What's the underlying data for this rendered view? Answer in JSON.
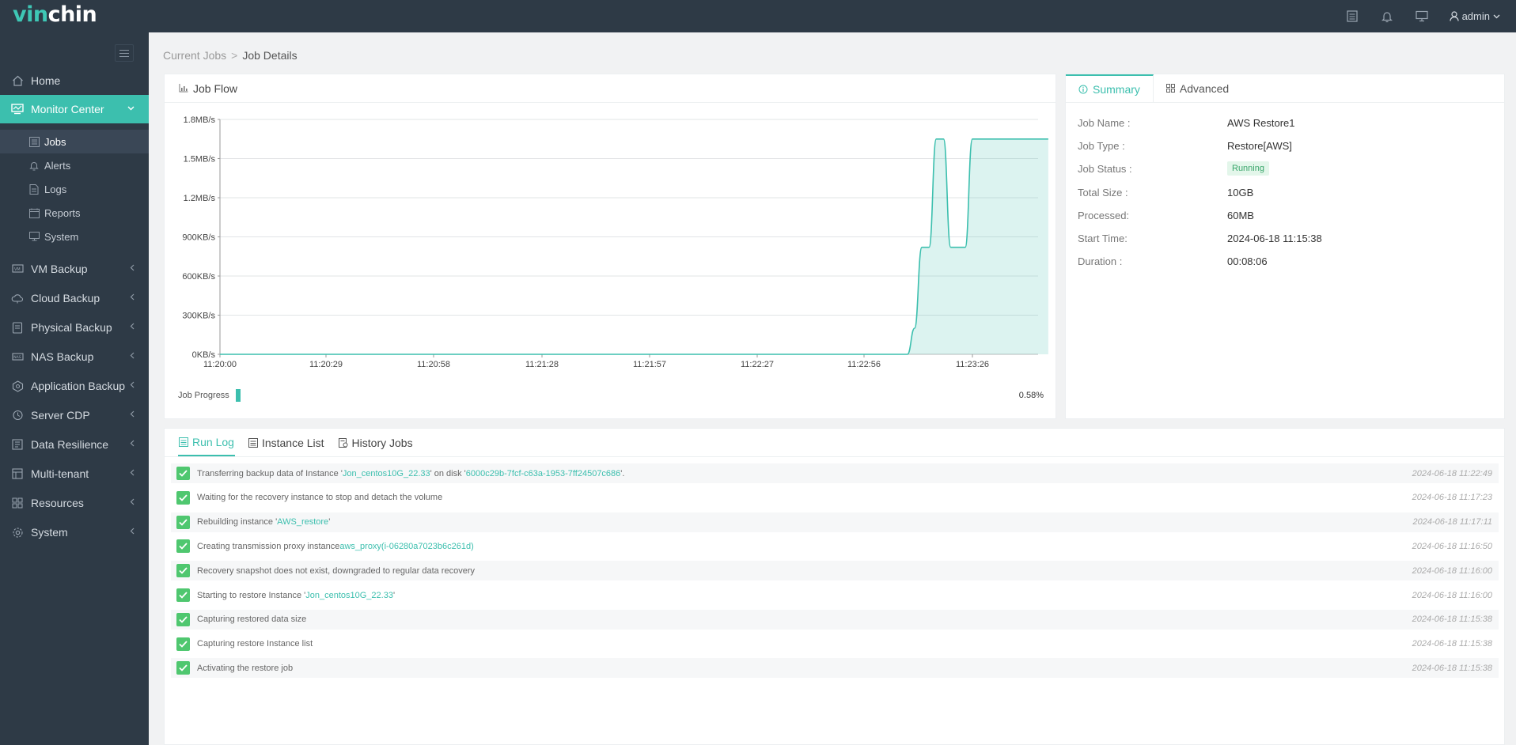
{
  "app": {
    "logo_prefix": "vin",
    "logo_suffix": "chin",
    "user": "admin"
  },
  "sidebar": {
    "items": [
      {
        "label": "Home",
        "icon": "home-icon"
      },
      {
        "label": "Monitor Center",
        "icon": "monitor-icon",
        "active": true
      },
      {
        "label": "VM Backup",
        "icon": "vm-icon"
      },
      {
        "label": "Cloud Backup",
        "icon": "cloud-icon"
      },
      {
        "label": "Physical Backup",
        "icon": "server-icon"
      },
      {
        "label": "NAS Backup",
        "icon": "nas-icon"
      },
      {
        "label": "Application Backup",
        "icon": "app-icon"
      },
      {
        "label": "Server CDP",
        "icon": "cdp-icon"
      },
      {
        "label": "Data Resilience",
        "icon": "resilience-icon"
      },
      {
        "label": "Multi-tenant",
        "icon": "tenant-icon"
      },
      {
        "label": "Resources",
        "icon": "resources-icon"
      },
      {
        "label": "System",
        "icon": "gear-icon"
      }
    ],
    "sub_items": [
      {
        "label": "Jobs",
        "icon": "list-icon",
        "selected": true
      },
      {
        "label": "Alerts",
        "icon": "bell-icon"
      },
      {
        "label": "Logs",
        "icon": "log-icon"
      },
      {
        "label": "Reports",
        "icon": "report-icon"
      },
      {
        "label": "System",
        "icon": "system-icon"
      }
    ]
  },
  "breadcrumb": {
    "parent": "Current Jobs",
    "separator": ">",
    "current": "Job Details"
  },
  "job_flow": {
    "title": "Job Flow",
    "progress_label": "Job Progress",
    "progress_value": "0.58%",
    "progress_fraction": 0.0058
  },
  "chart_data": {
    "type": "area",
    "title": "",
    "xlabel": "",
    "ylabel": "",
    "y_ticks": [
      "0KB/s",
      "300KB/s",
      "600KB/s",
      "900KB/s",
      "1.2MB/s",
      "1.5MB/s",
      "1.8MB/s"
    ],
    "x_ticks": [
      "11:20:00",
      "11:20:29",
      "11:20:58",
      "11:21:28",
      "11:21:57",
      "11:22:27",
      "11:22:56",
      "11:23:26"
    ],
    "ylim": [
      0,
      1800
    ],
    "y_unit": "KB/s",
    "grid": true,
    "color": "#3cbfae",
    "series": [
      {
        "x": [
          "11:20:00",
          "11:23:08",
          "11:23:10",
          "11:23:12",
          "11:23:14",
          "11:23:16",
          "11:23:18",
          "11:23:20",
          "11:23:22",
          "11:23:24",
          "11:23:26",
          "11:23:28",
          "11:23:30",
          "11:23:32",
          "11:23:45",
          "11:23:47"
        ],
        "values": [
          0,
          0,
          200,
          820,
          820,
          1650,
          1650,
          820,
          820,
          820,
          1650,
          1650,
          1650,
          1650,
          1650,
          1650
        ]
      }
    ]
  },
  "summary": {
    "tabs": [
      "Summary",
      "Advanced"
    ],
    "rows": [
      {
        "label": "Job Name :",
        "value": "AWS Restore1"
      },
      {
        "label": "Job Type :",
        "value": "Restore[AWS]"
      },
      {
        "label": "Job Status :",
        "value": "Running",
        "badge": true
      },
      {
        "label": "Total Size :",
        "value": "10GB"
      },
      {
        "label": "Processed:",
        "value": "60MB"
      },
      {
        "label": "Start Time:",
        "value": "2024-06-18 11:15:38"
      },
      {
        "label": "Duration :",
        "value": "00:08:06"
      }
    ]
  },
  "log": {
    "tabs": [
      "Run Log",
      "Instance List",
      "History Jobs"
    ],
    "rows": [
      {
        "parts": [
          [
            "Transferring backup data of Instance '",
            0
          ],
          [
            "Jon_centos10G_22.33",
            1
          ],
          [
            "' on disk '",
            0
          ],
          [
            "6000c29b-7fcf-c63a-1953-7ff24507c686",
            1
          ],
          [
            "'.",
            0
          ]
        ],
        "time": "2024-06-18 11:22:49"
      },
      {
        "parts": [
          [
            "Waiting for the recovery instance to stop and detach the volume",
            0
          ]
        ],
        "time": "2024-06-18 11:17:23"
      },
      {
        "parts": [
          [
            "Rebuilding instance '",
            0
          ],
          [
            "AWS_restore",
            1
          ],
          [
            "'",
            0
          ]
        ],
        "time": "2024-06-18 11:17:11"
      },
      {
        "parts": [
          [
            "Creating transmission proxy instance",
            0
          ],
          [
            "aws_proxy(i-06280a7023b6c261d)",
            1
          ]
        ],
        "time": "2024-06-18 11:16:50"
      },
      {
        "parts": [
          [
            "Recovery snapshot does not exist, downgraded to regular data recovery",
            0
          ]
        ],
        "time": "2024-06-18 11:16:00"
      },
      {
        "parts": [
          [
            "Starting to restore Instance '",
            0
          ],
          [
            "Jon_centos10G_22.33",
            1
          ],
          [
            "'",
            0
          ]
        ],
        "time": "2024-06-18 11:16:00"
      },
      {
        "parts": [
          [
            "Capturing restored data size",
            0
          ]
        ],
        "time": "2024-06-18 11:15:38"
      },
      {
        "parts": [
          [
            "Capturing restore Instance list",
            0
          ]
        ],
        "time": "2024-06-18 11:15:38"
      },
      {
        "parts": [
          [
            "Activating the restore job",
            0
          ]
        ],
        "time": "2024-06-18 11:15:38"
      }
    ]
  }
}
